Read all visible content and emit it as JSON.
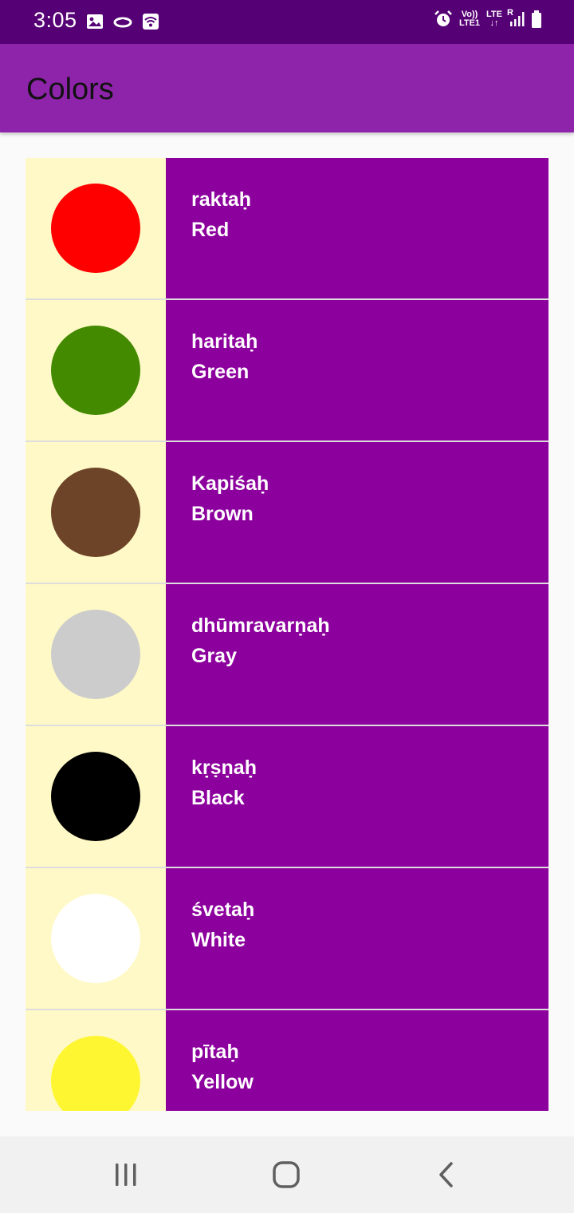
{
  "status_bar": {
    "time": "3:05",
    "left_icons": [
      "image-icon",
      "link-icon",
      "wifi-icon"
    ],
    "volte_label_top": "Vo))",
    "volte_label_bottom": "LTE1",
    "lte_label": "LTE",
    "roaming_label": "R",
    "right_icons": [
      "alarm-icon",
      "signal-icon",
      "battery-icon"
    ]
  },
  "app_bar": {
    "title": "Colors"
  },
  "colors": [
    {
      "sanskrit": "raktaḥ",
      "english": "Red",
      "swatch": "#ff0000"
    },
    {
      "sanskrit": "haritaḥ",
      "english": "Green",
      "swatch": "#438a00"
    },
    {
      "sanskrit": "Kapiśaḥ",
      "english": "Brown",
      "swatch": "#6d4428"
    },
    {
      "sanskrit": "dhūmravarṇaḥ",
      "english": "Gray",
      "swatch": "#cccccc"
    },
    {
      "sanskrit": "kṛṣṇaḥ",
      "english": "Black",
      "swatch": "#000000"
    },
    {
      "sanskrit": "śvetaḥ",
      "english": "White",
      "swatch": "#ffffff"
    },
    {
      "sanskrit": "pītaḥ",
      "english": "Yellow",
      "swatch": "#fff632"
    }
  ],
  "theme": {
    "status_bar": "#560075",
    "app_bar": "#8e24aa",
    "text_panel": "#8c009d",
    "thumb_background": "#fff9c7"
  },
  "nav_bar": {
    "buttons": [
      "recents-icon",
      "home-icon",
      "back-icon"
    ]
  }
}
